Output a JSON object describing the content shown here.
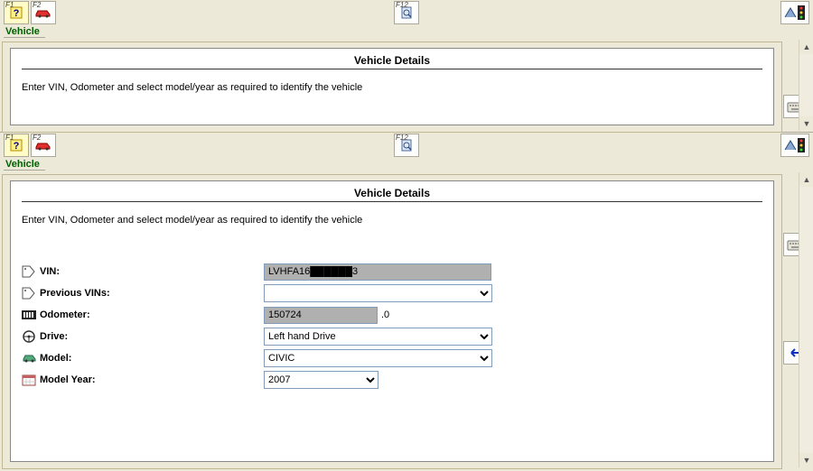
{
  "toolbar": {
    "f1": "F1",
    "f2": "F2",
    "f12": "F12"
  },
  "tab": "Vehicle",
  "panel": {
    "title": "Vehicle Details",
    "instruction_a": "Enter VIN, Odometer and select model/year as required to identify the ",
    "instruction_b": "vehicle"
  },
  "form": {
    "vin_label": "VIN:",
    "vin_value": "LVHFA16██████3",
    "prev_vin_label": "Previous VINs:",
    "prev_vin_value": "",
    "odo_label": "Odometer:",
    "odo_value": "150724",
    "odo_suffix": ".0",
    "drive_label": "Drive:",
    "drive_value": "Left hand Drive",
    "model_label": "Model:",
    "model_value": "CIVIC",
    "year_label": "Model Year:",
    "year_value": "2007"
  }
}
